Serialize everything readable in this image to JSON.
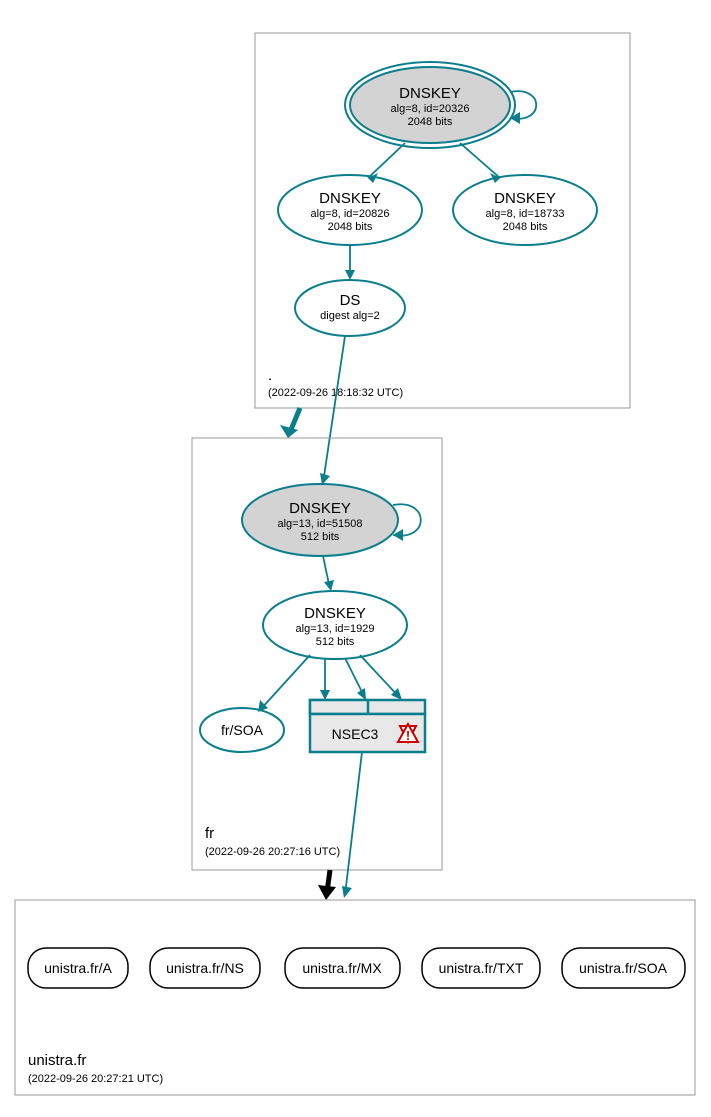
{
  "zones": {
    "root": {
      "name": ".",
      "timestamp": "(2022-09-26 18:18:32 UTC)",
      "nodes": {
        "ksk": {
          "title": "DNSKEY",
          "line1": "alg=8, id=20326",
          "line2": "2048 bits"
        },
        "zsk1": {
          "title": "DNSKEY",
          "line1": "alg=8, id=20826",
          "line2": "2048 bits"
        },
        "zsk2": {
          "title": "DNSKEY",
          "line1": "alg=8, id=18733",
          "line2": "2048 bits"
        },
        "ds": {
          "title": "DS",
          "line1": "digest alg=2"
        }
      }
    },
    "fr": {
      "name": "fr",
      "timestamp": "(2022-09-26 20:27:16 UTC)",
      "nodes": {
        "ksk": {
          "title": "DNSKEY",
          "line1": "alg=13, id=51508",
          "line2": "512 bits"
        },
        "zsk": {
          "title": "DNSKEY",
          "line1": "alg=13, id=1929",
          "line2": "512 bits"
        },
        "soa": {
          "title": "fr/SOA"
        },
        "nsec3": {
          "title": "NSEC3"
        }
      }
    },
    "unistra": {
      "name": "unistra.fr",
      "timestamp": "(2022-09-26 20:27:21 UTC)",
      "rrsets": {
        "a": "unistra.fr/A",
        "ns": "unistra.fr/NS",
        "mx": "unistra.fr/MX",
        "txt": "unistra.fr/TXT",
        "soa": "unistra.fr/SOA"
      }
    }
  }
}
